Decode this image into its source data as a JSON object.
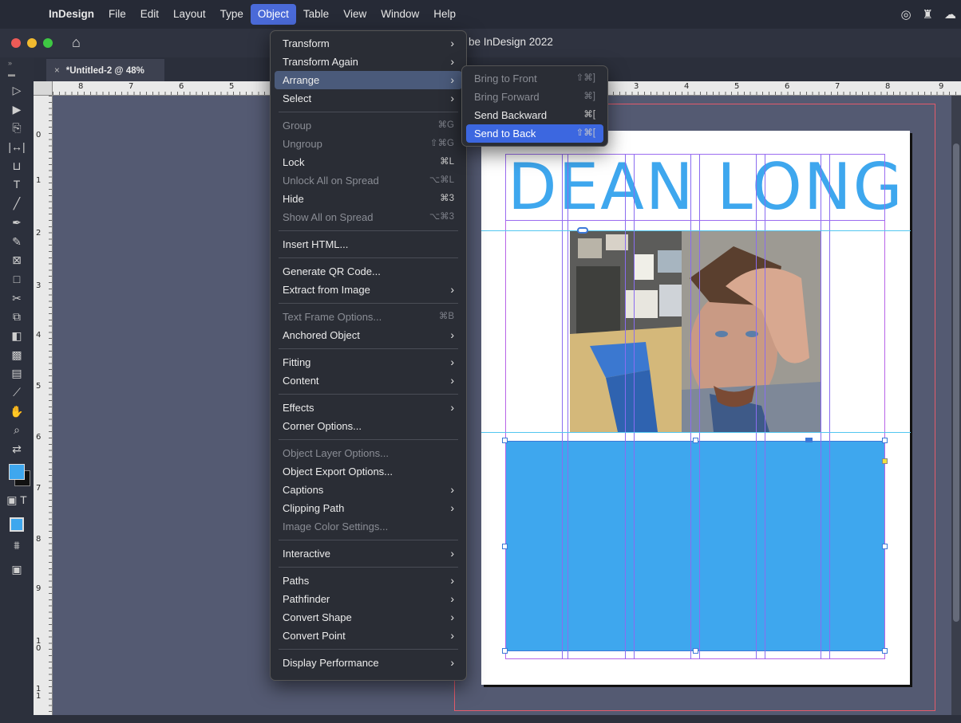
{
  "menubar": {
    "items": [
      "InDesign",
      "File",
      "Edit",
      "Layout",
      "Type",
      "Object",
      "Table",
      "View",
      "Window",
      "Help"
    ],
    "active": "Object"
  },
  "window": {
    "title": "be InDesign 2022",
    "tab_title": "*Untitled-2 @ 48%",
    "tab_close": "×"
  },
  "rulers": {
    "h": [
      "8",
      "7",
      "6",
      "5",
      "3",
      "4",
      "5",
      "6",
      "7",
      "8",
      "9"
    ],
    "v": [
      "0",
      "1",
      "2",
      "3",
      "4",
      "5",
      "6",
      "7",
      "8",
      "9",
      "1\n0",
      "1\n1"
    ]
  },
  "document": {
    "headline": "DEAN LONG",
    "colors": {
      "headline": "#3ea7ee",
      "box": "#3ea7ee",
      "guides": "#52c7f0",
      "columns": "#8a6cf0",
      "bleed": "#e45b6b"
    }
  },
  "object_menu": {
    "items": [
      {
        "label": "Transform",
        "submenu": true
      },
      {
        "label": "Transform Again",
        "submenu": true
      },
      {
        "label": "Arrange",
        "submenu": true,
        "state": "highlight"
      },
      {
        "label": "Select",
        "submenu": true
      },
      {
        "separator": true
      },
      {
        "label": "Group",
        "shortcut": "⌘G",
        "disabled": true
      },
      {
        "label": "Ungroup",
        "shortcut": "⇧⌘G",
        "disabled": true
      },
      {
        "label": "Lock",
        "shortcut": "⌘L"
      },
      {
        "label": "Unlock All on Spread",
        "shortcut": "⌥⌘L",
        "disabled": true
      },
      {
        "label": "Hide",
        "shortcut": "⌘3"
      },
      {
        "label": "Show All on Spread",
        "shortcut": "⌥⌘3",
        "disabled": true
      },
      {
        "separator": true
      },
      {
        "label": "Insert HTML..."
      },
      {
        "separator": true
      },
      {
        "label": "Generate QR Code..."
      },
      {
        "label": "Extract from Image",
        "submenu": true
      },
      {
        "separator": true
      },
      {
        "label": "Text Frame Options...",
        "shortcut": "⌘B",
        "disabled": true
      },
      {
        "label": "Anchored Object",
        "submenu": true
      },
      {
        "separator": true
      },
      {
        "label": "Fitting",
        "submenu": true
      },
      {
        "label": "Content",
        "submenu": true
      },
      {
        "separator": true
      },
      {
        "label": "Effects",
        "submenu": true
      },
      {
        "label": "Corner Options..."
      },
      {
        "separator": true
      },
      {
        "label": "Object Layer Options...",
        "disabled": true
      },
      {
        "label": "Object Export Options..."
      },
      {
        "label": "Captions",
        "submenu": true
      },
      {
        "label": "Clipping Path",
        "submenu": true
      },
      {
        "label": "Image Color Settings...",
        "disabled": true
      },
      {
        "separator": true
      },
      {
        "label": "Interactive",
        "submenu": true
      },
      {
        "separator": true
      },
      {
        "label": "Paths",
        "submenu": true
      },
      {
        "label": "Pathfinder",
        "submenu": true
      },
      {
        "label": "Convert Shape",
        "submenu": true
      },
      {
        "label": "Convert Point",
        "submenu": true
      },
      {
        "separator": true
      },
      {
        "label": "Display Performance",
        "submenu": true
      }
    ]
  },
  "arrange_submenu": {
    "items": [
      {
        "label": "Bring to Front",
        "shortcut": "⇧⌘]",
        "disabled": true
      },
      {
        "label": "Bring Forward",
        "shortcut": "⌘]",
        "disabled": true
      },
      {
        "label": "Send Backward",
        "shortcut": "⌘["
      },
      {
        "label": "Send to Back",
        "shortcut": "⇧⌘[",
        "state": "selected"
      }
    ]
  }
}
